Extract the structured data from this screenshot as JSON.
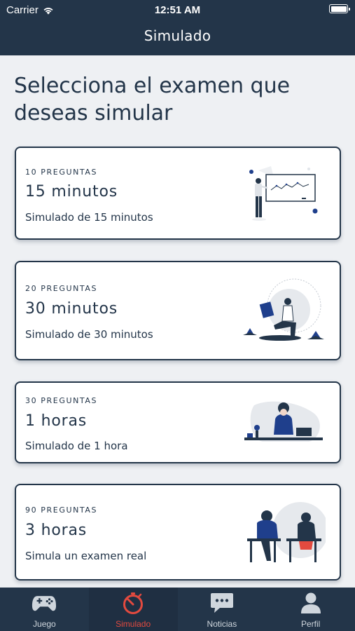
{
  "status_bar": {
    "carrier": "Carrier",
    "time": "12:51 AM"
  },
  "header": {
    "title": "Simulado"
  },
  "heading": "Selecciona el examen que deseas simular",
  "exams": [
    {
      "questions": "10 PREGUNTAS",
      "title": "15 minutos",
      "description": "Simulado de 15 minutos",
      "illustration": "teacher-whiteboard-illustration"
    },
    {
      "questions": "20 PREGUNTAS",
      "title": "30 minutos",
      "description": "Simulado de 30 minutos",
      "illustration": "reading-book-illustration"
    },
    {
      "questions": "30 PREGUNTAS",
      "title": "1 horas",
      "description": "Simulado de 1 hora",
      "illustration": "laptop-desk-illustration"
    },
    {
      "questions": "90 PREGUNTAS",
      "title": "3 horas",
      "description": "Simula un examen real",
      "illustration": "students-exam-illustration"
    }
  ],
  "tabs": [
    {
      "label": "Juego",
      "icon": "gamepad-icon",
      "active": false
    },
    {
      "label": "Simulado",
      "icon": "stopwatch-icon",
      "active": true
    },
    {
      "label": "Noticias",
      "icon": "chat-bubble-icon",
      "active": false
    },
    {
      "label": "Perfil",
      "icon": "user-icon",
      "active": false
    }
  ],
  "colors": {
    "navy": "#233549",
    "accent": "#e34a3f",
    "background": "#eef0f3",
    "illustration_blue": "#1f3f8c"
  }
}
